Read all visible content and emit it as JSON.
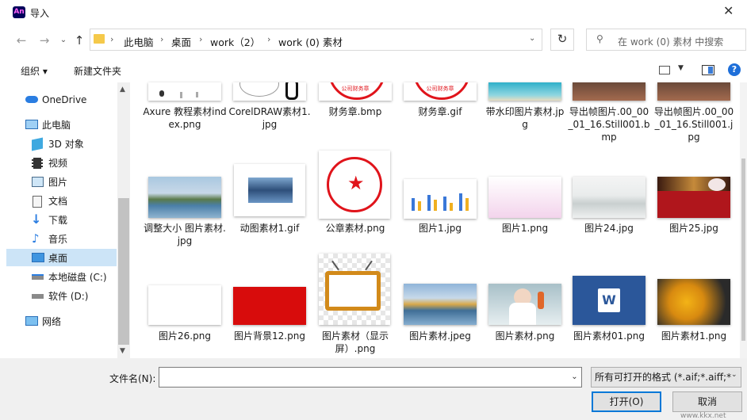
{
  "window": {
    "title": "导入",
    "app_icon": "An",
    "close": "✕"
  },
  "nav": {
    "back": "←",
    "forward": "→",
    "up": "↑",
    "refresh": "↻",
    "breadcrumbs": [
      "此电脑",
      "桌面",
      "work（2）",
      "work (0) 素材"
    ],
    "search_placeholder": "在 work (0) 素材 中搜索"
  },
  "toolbar": {
    "organize": "组织 ▾",
    "new_folder": "新建文件夹"
  },
  "sidebar": {
    "items": [
      {
        "label": "OneDrive",
        "icon": "cloud-icon"
      },
      {
        "label": "此电脑",
        "icon": "computer-icon"
      },
      {
        "label": "3D 对象",
        "icon": "3d-objects-icon"
      },
      {
        "label": "视频",
        "icon": "video-icon"
      },
      {
        "label": "图片",
        "icon": "pictures-icon"
      },
      {
        "label": "文档",
        "icon": "documents-icon"
      },
      {
        "label": "下载",
        "icon": "download-icon"
      },
      {
        "label": "音乐",
        "icon": "music-icon"
      },
      {
        "label": "桌面",
        "icon": "desktop-icon",
        "selected": true
      },
      {
        "label": "本地磁盘 (C:)",
        "icon": "drive-icon"
      },
      {
        "label": "软件 (D:)",
        "icon": "drive-icon"
      },
      {
        "label": "网络",
        "icon": "network-icon"
      }
    ]
  },
  "files": [
    {
      "name": "Axure 教程素材index.png"
    },
    {
      "name": "CorelDRAW素材1.jpg"
    },
    {
      "name": "财务章.bmp"
    },
    {
      "name": "财务章.gif"
    },
    {
      "name": "带水印图片素材.jpg"
    },
    {
      "name": "导出帧图片.00_00_01_16.Still001.bmp"
    },
    {
      "name": "导出帧图片.00_00_01_16.Still001.jpg"
    },
    {
      "name": "调整大小 图片素材.jpg"
    },
    {
      "name": "动图素材1.gif"
    },
    {
      "name": "公章素材.png"
    },
    {
      "name": "图片1.jpg"
    },
    {
      "name": "图片1.png"
    },
    {
      "name": "图片24.jpg"
    },
    {
      "name": "图片25.jpg"
    },
    {
      "name": "图片26.png"
    },
    {
      "name": "图片背景12.png"
    },
    {
      "name": "图片素材（显示屏）.png"
    },
    {
      "name": "图片素材.jpeg"
    },
    {
      "name": "图片素材.png"
    },
    {
      "name": "图片素材01.png"
    },
    {
      "name": "图片素材1.png"
    }
  ],
  "seal_text": "公司财务章",
  "bottom": {
    "filename_label": "文件名(N):",
    "filename_value": "",
    "filter": "所有可打开的格式 (*.aif;*.aiff;*",
    "open": "打开(O)",
    "cancel": "取消"
  },
  "watermark": "www.kkx.net"
}
